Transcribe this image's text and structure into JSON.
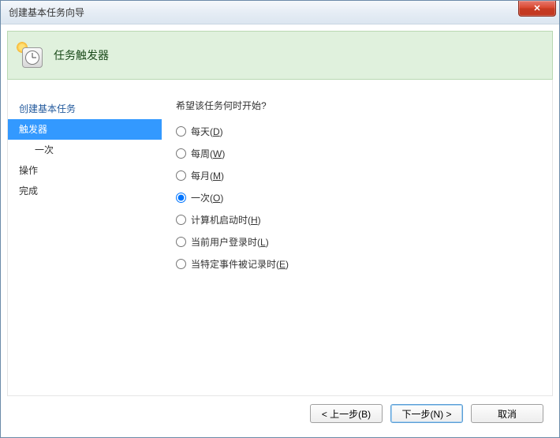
{
  "window": {
    "title": "创建基本任务向导",
    "close_label": "✕"
  },
  "header": {
    "title": "任务触发器"
  },
  "sidebar": {
    "items": [
      {
        "label": "创建基本任务",
        "selected": false,
        "sub": false,
        "plain": false
      },
      {
        "label": "触发器",
        "selected": true,
        "sub": false,
        "plain": false
      },
      {
        "label": "一次",
        "selected": false,
        "sub": true,
        "plain": false
      },
      {
        "label": "操作",
        "selected": false,
        "sub": false,
        "plain": true
      },
      {
        "label": "完成",
        "selected": false,
        "sub": false,
        "plain": true
      }
    ]
  },
  "main": {
    "question": "希望该任务何时开始?",
    "options": [
      {
        "text": "每天",
        "mnemonic": "D",
        "checked": false
      },
      {
        "text": "每周",
        "mnemonic": "W",
        "checked": false
      },
      {
        "text": "每月",
        "mnemonic": "M",
        "checked": false
      },
      {
        "text": "一次",
        "mnemonic": "O",
        "checked": true
      },
      {
        "text": "计算机启动时",
        "mnemonic": "H",
        "checked": false
      },
      {
        "text": "当前用户登录时",
        "mnemonic": "L",
        "checked": false
      },
      {
        "text": "当特定事件被记录时",
        "mnemonic": "E",
        "checked": false
      }
    ]
  },
  "buttons": {
    "back": "< 上一步(B)",
    "next": "下一步(N) >",
    "cancel": "取消"
  }
}
